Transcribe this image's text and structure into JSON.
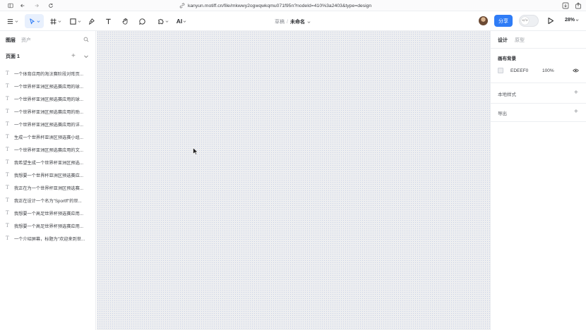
{
  "browser": {
    "url": "kanyun.motiff.cn/file/mkwwy2ogwqwkqmu071f95n?nodeId=410%3a2403&type=design"
  },
  "toolbar": {
    "ai_label": "AI",
    "breadcrumb_parent": "草稿",
    "breadcrumb_sep": "/",
    "breadcrumb_current": "未命名",
    "share_label": "分享",
    "dev_toggle_glyph": "</>",
    "zoom": "28%"
  },
  "left_panel": {
    "tabs": [
      "图层",
      "资产"
    ],
    "page_label": "页面 1",
    "page_add": "+",
    "layer_icon_glyph": "T",
    "layers": [
      "一个体育应用的淘汰赛阶段对阵页...",
      "一个世界杯亚洲区预选赛应用的球...",
      "一个世界杯亚洲区预选赛应用的球...",
      "一个世界杯亚洲区预选赛应用的助...",
      "一个世界杯亚洲区预选赛应用的详...",
      "生成一个世界杯亚洲区预选赛小组...",
      "一个世界杯亚洲区预选赛应用的文...",
      "我希望生成一个世界杯亚洲区预选...",
      "我想要一个世界杯亚洲区预选赛应...",
      "我正在为一个世界杯亚洲区预选赛...",
      "我正在设计一个名为\"Sportff\"的世...",
      "我想要一个高足世界杯预选赛应用...",
      "我想要一个高足世界杯预选赛应用...",
      "一个介绍屏幕，标题为\"欢迎来到世..."
    ]
  },
  "right_panel": {
    "tabs": [
      "设计",
      "原型"
    ],
    "bg_section_title": "画布背景",
    "bg_hex": "EDEEF0",
    "bg_opacity": "100%",
    "local_styles_label": "本地样式",
    "export_label": "导出",
    "plus": "+"
  },
  "colors": {
    "accent": "#2f7cf6",
    "canvas_bg": "#edeef0",
    "canvas_dots": "#c7d0e6"
  }
}
